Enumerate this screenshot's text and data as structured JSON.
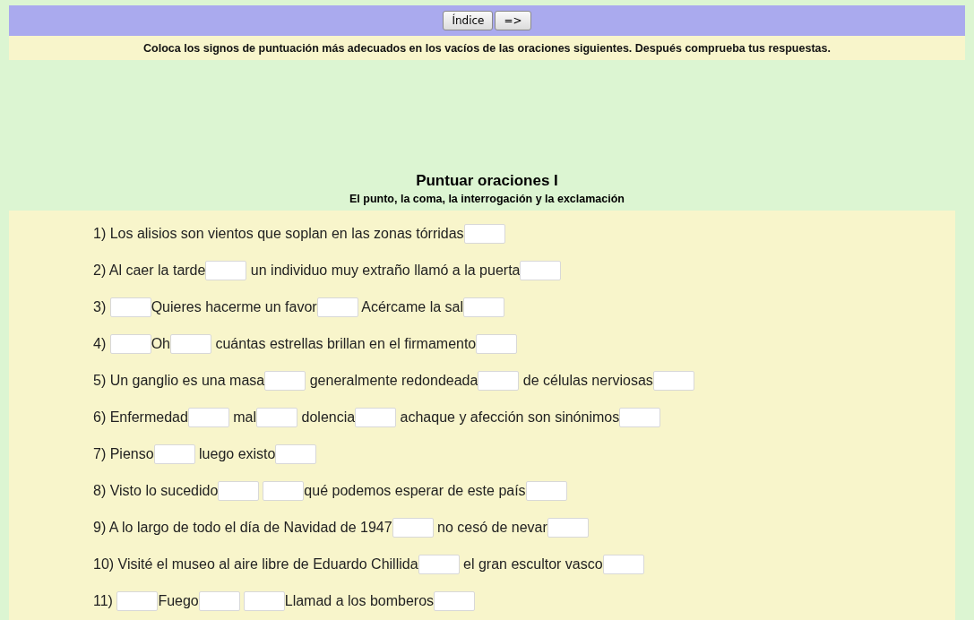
{
  "nav_buttons": [
    {
      "label": "Índice"
    },
    {
      "label": "=>"
    }
  ],
  "instructions": "Coloca los signos de puntuación más adecuados en los vacíos de las oraciones siguientes. Después comprueba tus respuestas.",
  "title": "Puntuar oraciones I",
  "subtitle": "El punto, la coma, la interrogación y la exclamación",
  "sentences": [
    {
      "parts": [
        {
          "kind": "text",
          "text": "1) Los alisios son vientos que soplan en las zonas tórridas"
        },
        {
          "kind": "blank"
        }
      ]
    },
    {
      "parts": [
        {
          "kind": "text",
          "text": "2) Al caer la tarde"
        },
        {
          "kind": "blank"
        },
        {
          "kind": "text",
          "text": " un individuo muy extraño llamó a la puerta"
        },
        {
          "kind": "blank"
        }
      ]
    },
    {
      "parts": [
        {
          "kind": "text",
          "text": "3) "
        },
        {
          "kind": "blank"
        },
        {
          "kind": "text",
          "text": "Quieres hacerme un favor"
        },
        {
          "kind": "blank"
        },
        {
          "kind": "text",
          "text": " Acércame la sal"
        },
        {
          "kind": "blank"
        }
      ]
    },
    {
      "parts": [
        {
          "kind": "text",
          "text": "4) "
        },
        {
          "kind": "blank"
        },
        {
          "kind": "text",
          "text": "Oh"
        },
        {
          "kind": "blank"
        },
        {
          "kind": "text",
          "text": " cuántas estrellas brillan en el firmamento"
        },
        {
          "kind": "blank"
        }
      ]
    },
    {
      "parts": [
        {
          "kind": "text",
          "text": "5) Un ganglio es una masa"
        },
        {
          "kind": "blank"
        },
        {
          "kind": "text",
          "text": " generalmente redondeada"
        },
        {
          "kind": "blank"
        },
        {
          "kind": "text",
          "text": " de células nerviosas"
        },
        {
          "kind": "blank"
        }
      ]
    },
    {
      "parts": [
        {
          "kind": "text",
          "text": "6) Enfermedad"
        },
        {
          "kind": "blank"
        },
        {
          "kind": "text",
          "text": " mal"
        },
        {
          "kind": "blank"
        },
        {
          "kind": "text",
          "text": " dolencia"
        },
        {
          "kind": "blank"
        },
        {
          "kind": "text",
          "text": " achaque y afección son sinónimos"
        },
        {
          "kind": "blank"
        }
      ]
    },
    {
      "parts": [
        {
          "kind": "text",
          "text": "7) Pienso"
        },
        {
          "kind": "blank"
        },
        {
          "kind": "text",
          "text": " luego existo"
        },
        {
          "kind": "blank"
        }
      ]
    },
    {
      "parts": [
        {
          "kind": "text",
          "text": "8) Visto lo sucedido"
        },
        {
          "kind": "blank"
        },
        {
          "kind": "blank"
        },
        {
          "kind": "text",
          "text": "qué podemos esperar de este país"
        },
        {
          "kind": "blank"
        }
      ]
    },
    {
      "parts": [
        {
          "kind": "text",
          "text": "9) A lo largo de todo el día de Navidad de 1947"
        },
        {
          "kind": "blank"
        },
        {
          "kind": "text",
          "text": " no cesó de nevar"
        },
        {
          "kind": "blank"
        }
      ]
    },
    {
      "parts": [
        {
          "kind": "text",
          "text": "10) Visité el museo al aire libre de Eduardo Chillida"
        },
        {
          "kind": "blank"
        },
        {
          "kind": "text",
          "text": " el gran escultor vasco"
        },
        {
          "kind": "blank"
        }
      ]
    },
    {
      "parts": [
        {
          "kind": "text",
          "text": "11) "
        },
        {
          "kind": "blank"
        },
        {
          "kind": "text",
          "text": "Fuego"
        },
        {
          "kind": "blank"
        },
        {
          "kind": "blank"
        },
        {
          "kind": "text",
          "text": "Llamad a los bomberos"
        },
        {
          "kind": "blank"
        }
      ]
    }
  ]
}
